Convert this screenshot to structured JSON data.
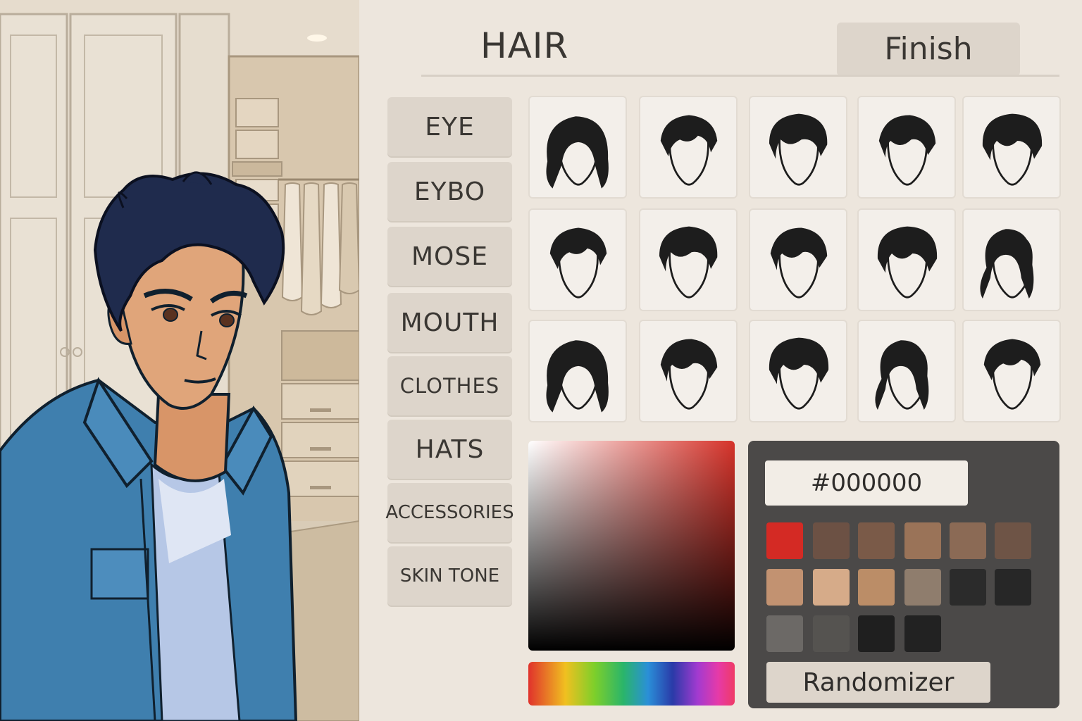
{
  "header": {
    "title": "HAIR",
    "finish_label": "Finish"
  },
  "categories": [
    {
      "label": "EYE"
    },
    {
      "label": "EYBO"
    },
    {
      "label": "MOSE"
    },
    {
      "label": "MOUTH"
    },
    {
      "label": "CLOTHES"
    },
    {
      "label": "HATS"
    },
    {
      "label": "ACCESSORIES"
    },
    {
      "label": "SKIN TONE"
    }
  ],
  "hair_styles": {
    "rows": 3,
    "cols": 5,
    "icon": "hair-silhouette-icon"
  },
  "color_picker": {
    "hex_value": "#000000",
    "base_hue": "#d6332a",
    "swatches": [
      "#d42a24",
      "#6c5144",
      "#7a5a48",
      "#9a7358",
      "#8b6a55",
      "#6e5446",
      "#c29271",
      "#d6ab89",
      "#bb8d67",
      "#8f7d6d",
      "#2b2b2b",
      "#272727",
      "#6c6966",
      "#555350",
      "#1f1f1f",
      "#222222"
    ],
    "randomizer_label": "Randomizer"
  },
  "colors": {
    "panel_bg": "#ede6dd",
    "button_bg": "#ddd5cb",
    "text": "#3a3733",
    "character_hair": "#1f2b4d",
    "shirt": "#3f7fae"
  }
}
